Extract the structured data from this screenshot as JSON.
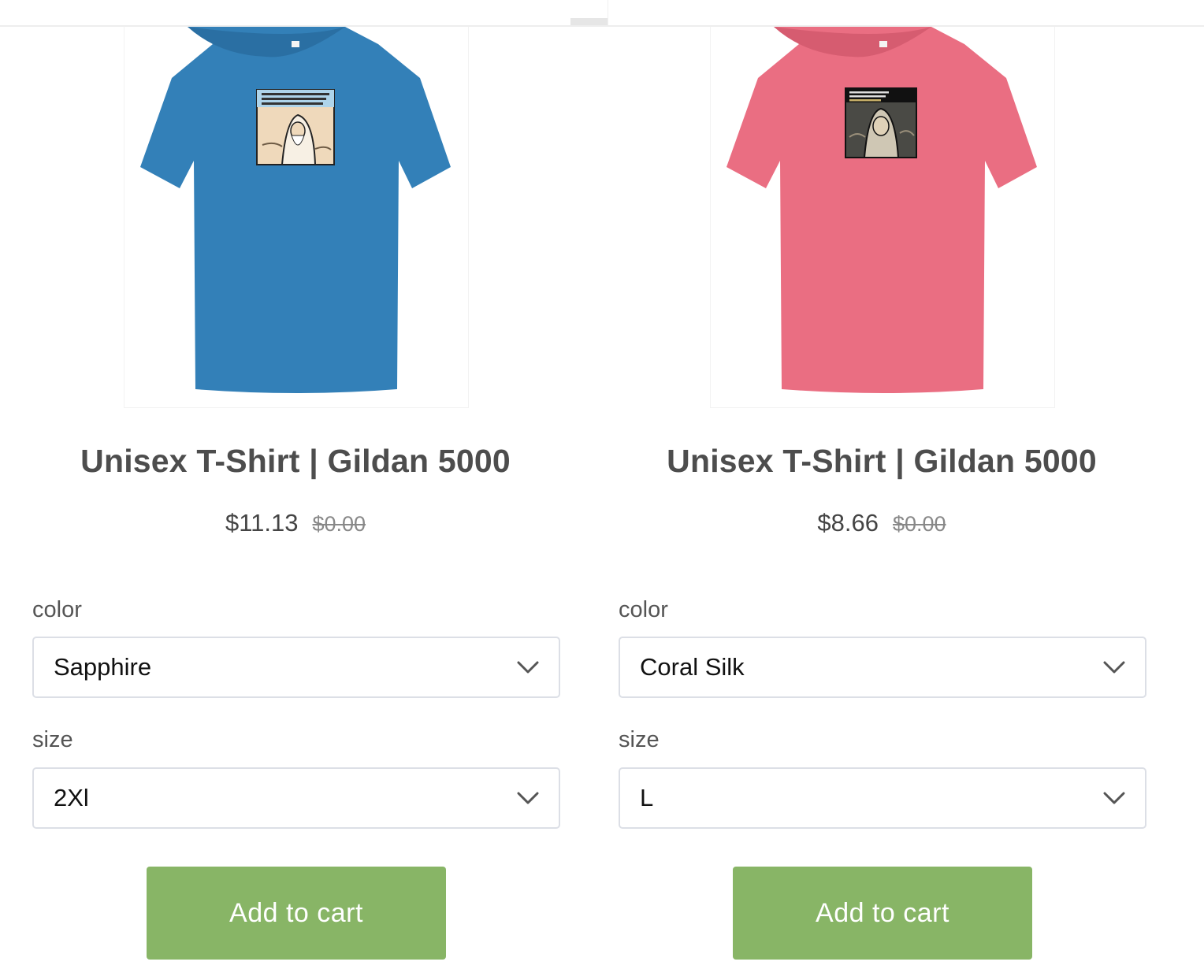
{
  "products": [
    {
      "shirt_color": "#3380b8",
      "title": "Unisex T-Shirt | Gildan 5000",
      "price": "$11.13",
      "old_price": "$0.00",
      "color_label": "color",
      "color_value": "Sapphire",
      "size_label": "size",
      "size_value": "2Xl",
      "add_to_cart": "Add to cart"
    },
    {
      "shirt_color": "#ea6e82",
      "title": "Unisex T-Shirt | Gildan 5000",
      "price": "$8.66",
      "old_price": "$0.00",
      "color_label": "color",
      "color_value": "Coral Silk",
      "size_label": "size",
      "size_value": "L",
      "add_to_cart": "Add to cart"
    }
  ],
  "colors": {
    "button": "#88b566",
    "title": "#4d4d4d"
  },
  "icons": {
    "select_chevron": "chevron-down-icon"
  }
}
